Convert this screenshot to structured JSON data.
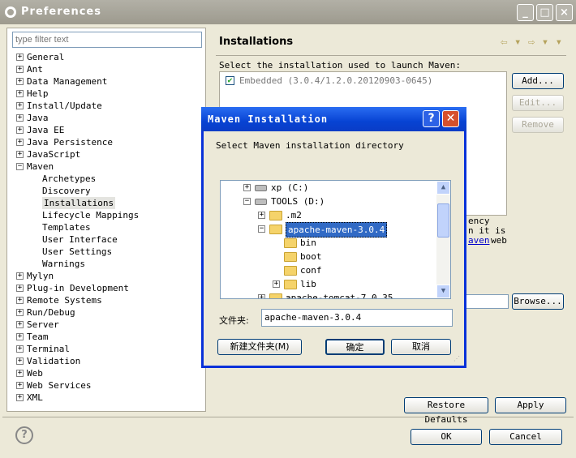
{
  "window": {
    "title": "Preferences",
    "controls": [
      "_",
      "□",
      "×"
    ]
  },
  "filter": {
    "placeholder": "type filter text"
  },
  "tree": {
    "items": [
      {
        "label": "General",
        "level": 0
      },
      {
        "label": "Ant",
        "level": 0
      },
      {
        "label": "Data Management",
        "level": 0
      },
      {
        "label": "Help",
        "level": 0
      },
      {
        "label": "Install/Update",
        "level": 0
      },
      {
        "label": "Java",
        "level": 0
      },
      {
        "label": "Java EE",
        "level": 0
      },
      {
        "label": "Java Persistence",
        "level": 0
      },
      {
        "label": "JavaScript",
        "level": 0
      },
      {
        "label": "Maven",
        "level": 0
      },
      {
        "label": "Archetypes",
        "level": 1
      },
      {
        "label": "Discovery",
        "level": 1
      },
      {
        "label": "Installations",
        "level": 1
      },
      {
        "label": "Lifecycle Mappings",
        "level": 1
      },
      {
        "label": "Templates",
        "level": 1
      },
      {
        "label": "User Interface",
        "level": 1
      },
      {
        "label": "User Settings",
        "level": 1
      },
      {
        "label": "Warnings",
        "level": 1
      },
      {
        "label": "Mylyn",
        "level": 0
      },
      {
        "label": "Plug-in Development",
        "level": 0
      },
      {
        "label": "Remote Systems",
        "level": 0
      },
      {
        "label": "Run/Debug",
        "level": 0
      },
      {
        "label": "Server",
        "level": 0
      },
      {
        "label": "Team",
        "level": 0
      },
      {
        "label": "Terminal",
        "level": 0
      },
      {
        "label": "Validation",
        "level": 0
      },
      {
        "label": "Web",
        "level": 0
      },
      {
        "label": "Web Services",
        "level": 0
      },
      {
        "label": "XML",
        "level": 0
      }
    ],
    "selected": "Installations"
  },
  "main": {
    "heading": "Installations",
    "description": "Select the installation used to launch Maven:",
    "installation": {
      "name": "Embedded (3.0.4/1.2.0.20120903-0645)",
      "checked": true
    },
    "buttons": {
      "add": "Add...",
      "edit": "Edit...",
      "remove": "Remove",
      "browse": "Browse..."
    },
    "partial_text": [
      "ency",
      "n it is",
      "aven",
      "web"
    ],
    "restore_defaults": "Restore Defaults",
    "apply": "Apply"
  },
  "footer": {
    "help": "?",
    "ok": "OK",
    "cancel": "Cancel"
  },
  "dialog": {
    "title": "Maven Installation",
    "message": "Select Maven installation directory",
    "folders": [
      {
        "label": "xp (C:)",
        "type": "drive",
        "expander": "+"
      },
      {
        "label": "TOOLS (D:)",
        "type": "drive",
        "expander": "-"
      },
      {
        "label": ".m2",
        "type": "folder",
        "expander": "+"
      },
      {
        "label": "apache-maven-3.0.4",
        "type": "folder-open",
        "expander": "-"
      },
      {
        "label": "bin",
        "type": "folder",
        "expander": ""
      },
      {
        "label": "boot",
        "type": "folder",
        "expander": ""
      },
      {
        "label": "conf",
        "type": "folder",
        "expander": ""
      },
      {
        "label": "lib",
        "type": "folder",
        "expander": "+"
      },
      {
        "label": "apache-tomcat-7.0.35",
        "type": "folder",
        "expander": "+"
      }
    ],
    "selected_folder": "apache-maven-3.0.4",
    "folder_label": "文件夹:",
    "folder_value": "apache-maven-3.0.4",
    "new_folder": "新建文件夹(M)",
    "ok": "确定",
    "cancel": "取消"
  }
}
